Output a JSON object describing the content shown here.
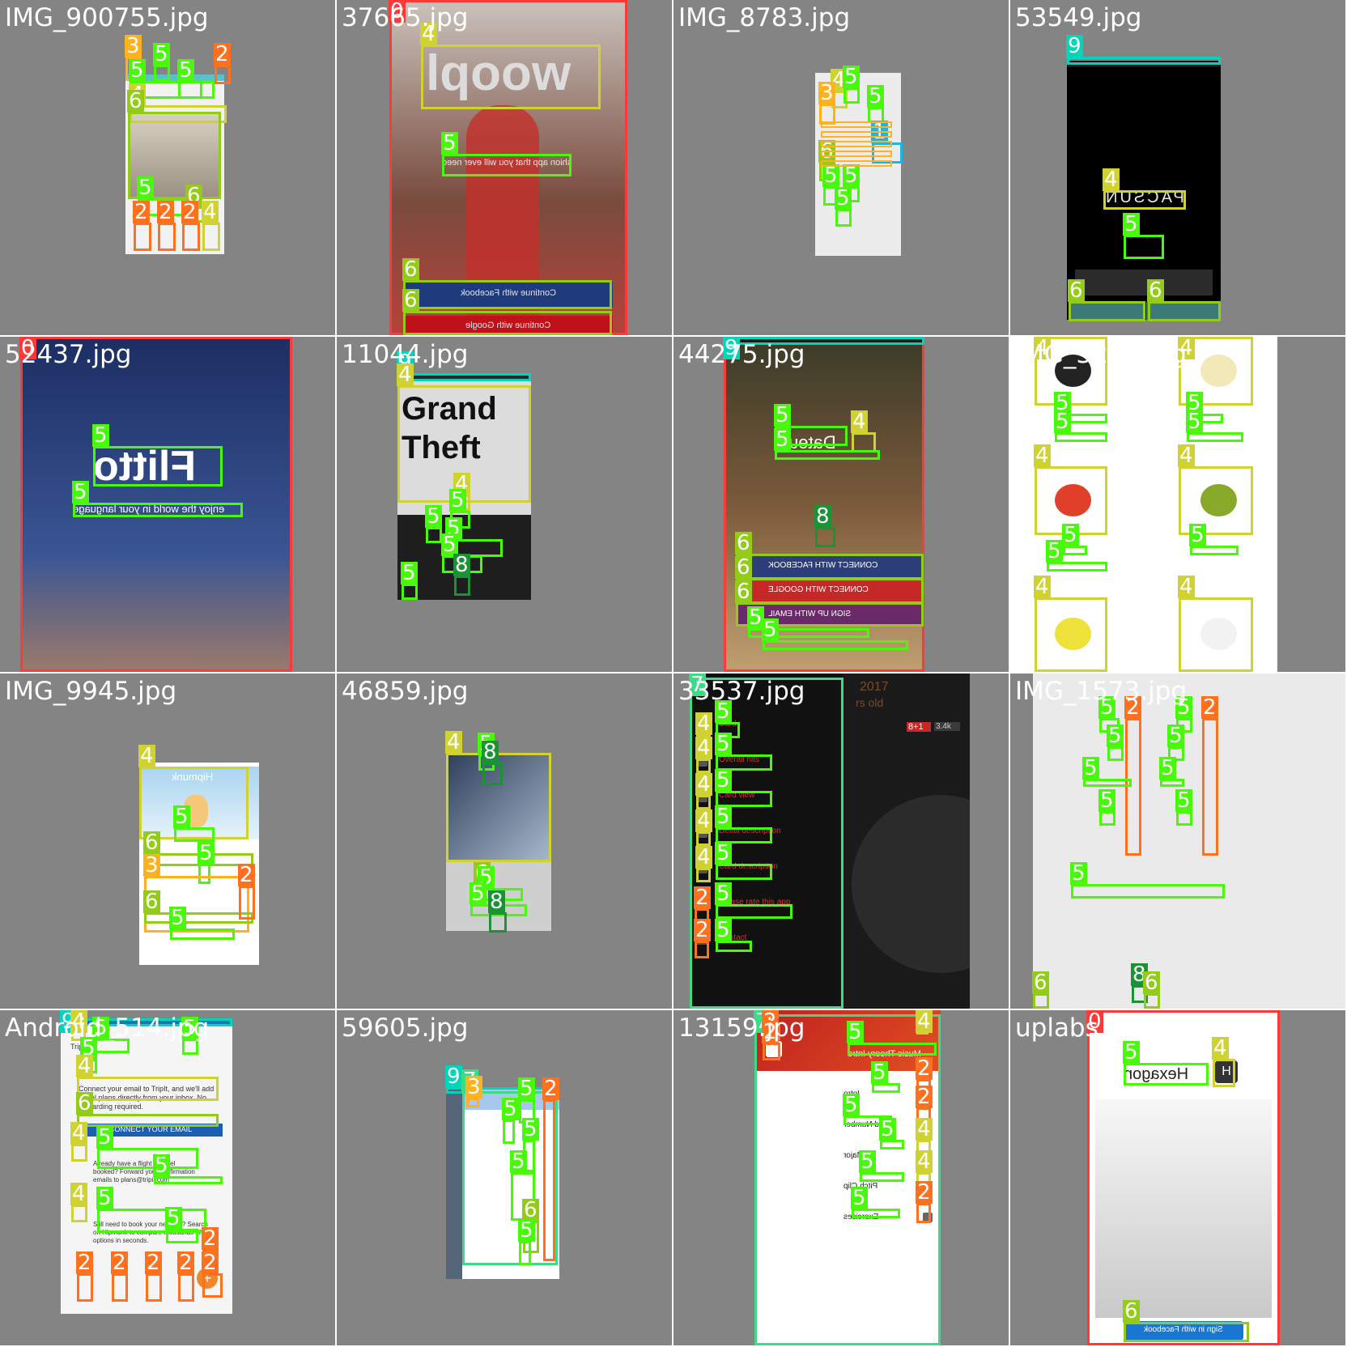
{
  "class_colors": {
    "0": "#ff3838",
    "1": "#1fb4e6",
    "2": "#ff701f",
    "3": "#ffb21d",
    "4": "#cfd231",
    "5": "#48f90a",
    "6": "#92cc17",
    "7": "#3ddb86",
    "8": "#1a9334",
    "9": "#00d4bb"
  },
  "tiles": [
    {
      "filename": "IMG_900755.jpg"
    },
    {
      "filename": "37665.jpg",
      "texts": {
        "logo": "woopl",
        "tagline": "the only fashion app that you will ever need",
        "btn_facebook": "Continue with Facebook",
        "btn_google": "Continue with Google"
      }
    },
    {
      "filename": "IMG_8783.jpg"
    },
    {
      "filename": "53549.jpg",
      "texts": {
        "logo": "PACSUN"
      }
    },
    {
      "filename": "52437.jpg",
      "texts": {
        "logo": "Flitto",
        "tagline": "enjoy the world in your language"
      }
    },
    {
      "filename": "11044.jpg",
      "texts": {
        "logo": "Grand Theft"
      }
    },
    {
      "filename": "44275.jpg",
      "texts": {
        "logo": "Dateu",
        "btn_facebook": "CONNECT WITH FACEBOOK",
        "btn_google": "CONNECT WITH GOOGLE",
        "btn_email": "SIGN UP WITH EMAIL"
      }
    },
    {
      "filename": "IMG_3294.jpg"
    },
    {
      "filename": "IMG_9945.jpg",
      "texts": {
        "logo": "Hipmunk"
      }
    },
    {
      "filename": "46859.jpg"
    },
    {
      "filename": "33537.jpg",
      "texts": {
        "year": "2017",
        "sub": "rs old",
        "badge": "8+1",
        "count": "3.4k",
        "menu": [
          "Card",
          "Overall hits",
          "Card view",
          "Detail description",
          "Card description",
          "Please rate this app",
          "Contact"
        ]
      }
    },
    {
      "filename": "IMG_1573.jpg"
    },
    {
      "filename": "Android_514.jpg",
      "texts": {
        "trip": "Trip",
        "connect_text": "Connect your email to TripIt, and we'll add travel plans directly from your inbox. No forwarding required.",
        "connect_btn": "CONNECT YOUR EMAIL",
        "forward_text": "Already have a flight or hotel booked? Forward your confirmation emails to plans@tripit.com",
        "hipmunk_text": "Still need to book your next trip? Search on Hipmunk to compare thousands of options in seconds."
      }
    },
    {
      "filename": "59605.jpg"
    },
    {
      "filename": "13159.jpg",
      "texts": {
        "header": "Music Theory Intro",
        "items": [
          "Intro",
          "Good Number",
          "Major",
          "Pitch Clip",
          "Exercises"
        ]
      }
    },
    {
      "filename": "uplabs_531.jpg",
      "texts": {
        "logo": "Hexagon",
        "icon": "H",
        "btn": "Sign in with Facebook"
      }
    }
  ]
}
